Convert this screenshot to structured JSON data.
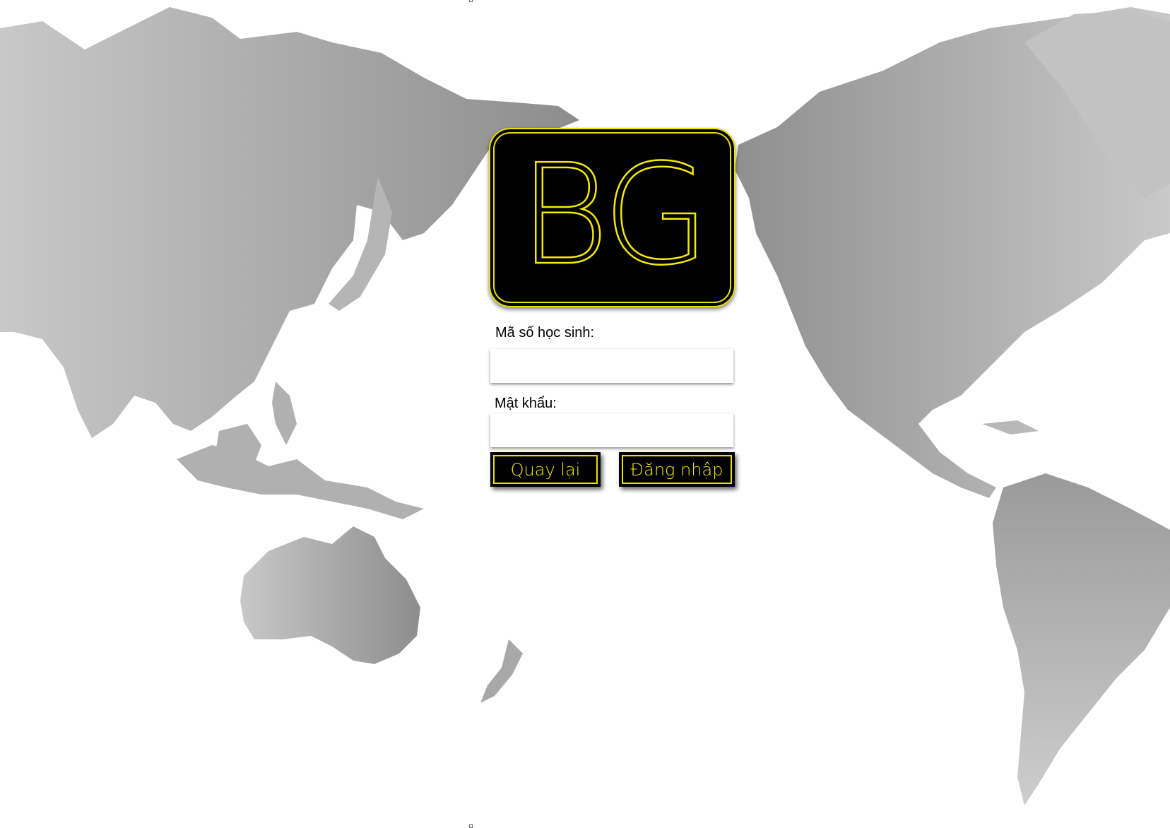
{
  "app": {
    "logo_text": "BG",
    "accent_color": "#f4ea00",
    "background_image": "world-map"
  },
  "login": {
    "student_id_label": "Mã số học sinh:",
    "student_id_value": "",
    "password_label": "Mật khẩu:",
    "password_value": "",
    "back_button": "Quay lại",
    "login_button": "Đăng nhập"
  }
}
